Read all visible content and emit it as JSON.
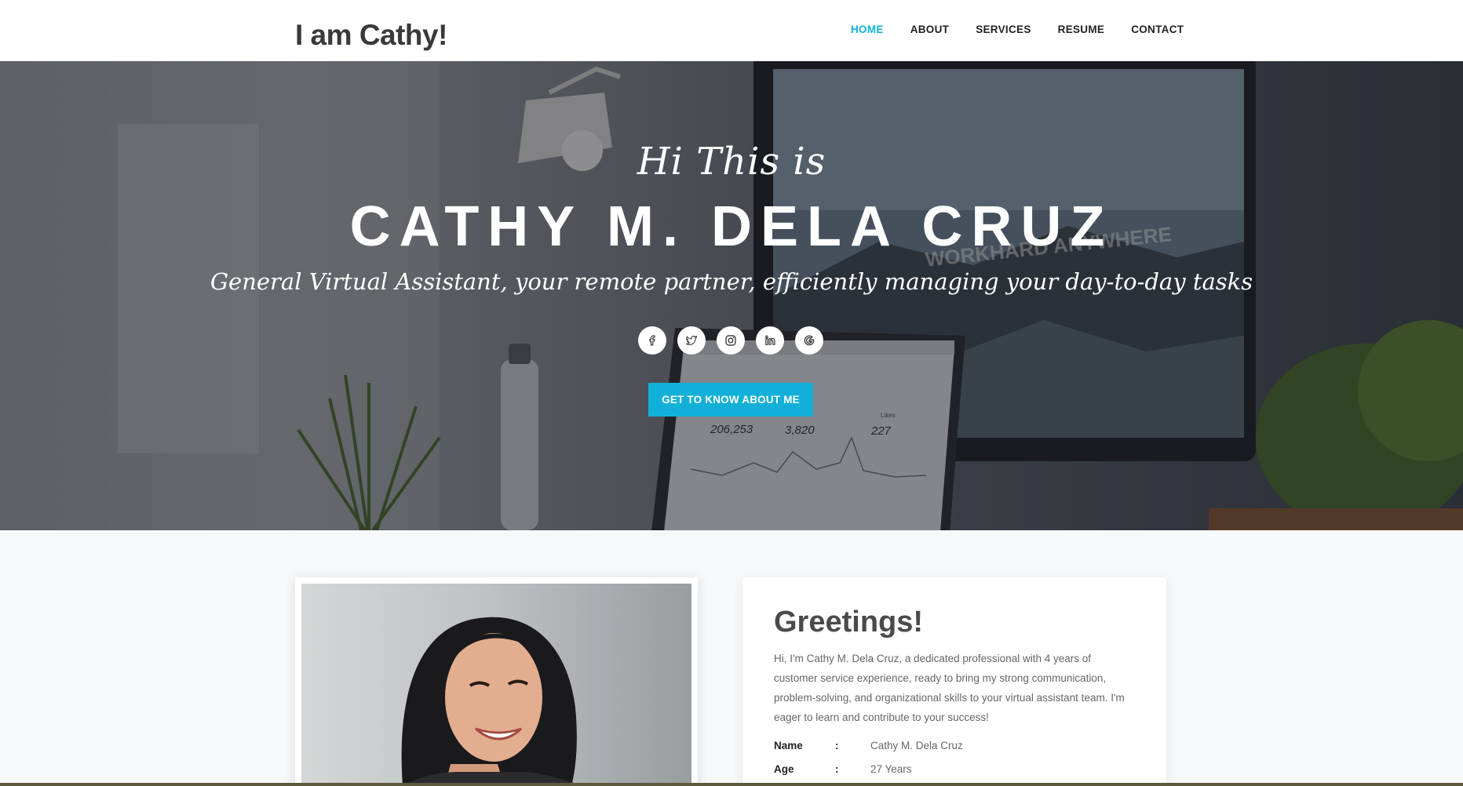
{
  "header": {
    "brand": "I am Cathy!",
    "nav": [
      {
        "label": "HOME",
        "active": true
      },
      {
        "label": "ABOUT"
      },
      {
        "label": "SERVICES"
      },
      {
        "label": "RESUME"
      },
      {
        "label": "CONTACT"
      }
    ]
  },
  "hero": {
    "greeting": "Hi This is",
    "name": "CATHY M. DELA CRUZ",
    "tagline": "General Virtual Assistant, your remote partner, efficiently managing your day-to-day tasks",
    "socials": [
      "facebook-icon",
      "twitter-icon",
      "instagram-icon",
      "linkedin-icon",
      "google-icon"
    ],
    "cta_label": "GET TO KNOW ABOUT ME",
    "background_photo": {
      "sticky_note": "WORKHARD ANYWHERE",
      "dashboard_stats": [
        "206,253",
        "3,820",
        "227"
      ],
      "likes_label": "Likes"
    }
  },
  "about": {
    "title": "Greetings!",
    "intro": "Hi, I'm Cathy M. Dela Cruz, a dedicated professional with 4 years of customer service experience, ready to bring my strong communication, problem-solving, and organizational skills to your virtual assistant team. I'm eager to learn and contribute to your success!",
    "details": [
      {
        "label": "Name",
        "value": "Cathy M. Dela Cruz"
      },
      {
        "label": "Age",
        "value": "27 Years"
      }
    ]
  },
  "colors": {
    "accent": "#12b0d8",
    "heading": "#4a4a4a",
    "body_text": "#666666",
    "background": "#f7f8fa"
  }
}
